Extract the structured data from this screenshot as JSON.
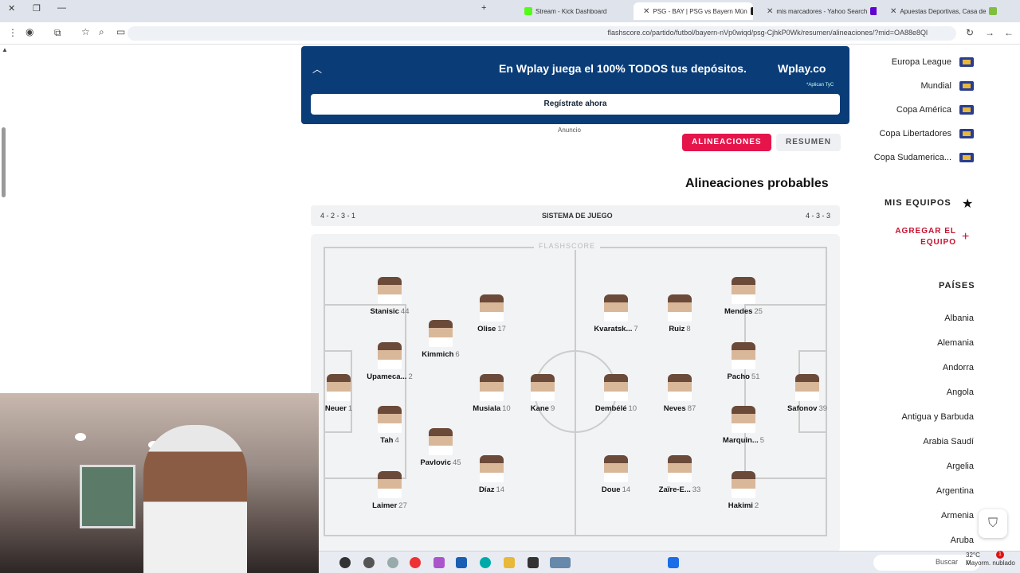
{
  "browser": {
    "tabs": [
      {
        "title": "Apuestas Deportivas, Casa de"
      },
      {
        "title": "mis marcadores - Yahoo Search"
      },
      {
        "title": "PSG - BAY | PSG vs Bayern Mün"
      },
      {
        "title": "Stream - Kick Dashboard"
      }
    ],
    "url": "flashscore.co/partido/futbol/bayern-nVp0wiqd/psg-CjhkP0Wk/resumen/alineaciones/?mid=OA88e8Ql"
  },
  "ad": {
    "brand": "Wplay.co",
    "headline": "En Wplay juega el 100% TODOS tus depósitos.",
    "note": "*Aplican TyC",
    "button": "Regístrate ahora",
    "label": "Anuncio"
  },
  "match_tabs": {
    "resumen": "RESUMEN",
    "alineaciones": "ALINEACIONES"
  },
  "lineup": {
    "title": "Alineaciones probables",
    "system_label": "SISTEMA DE JUEGO",
    "home_formation": "4 - 3 - 3",
    "away_formation": "4 - 2 - 3 - 1",
    "watermark": "FLASHSCORE"
  },
  "players": [
    {
      "num": "25",
      "name": "Mendes"
    },
    {
      "num": "8",
      "name": "Ruiz"
    },
    {
      "num": "7",
      "name": "Kvaratsk..."
    },
    {
      "num": "51",
      "name": "Pacho"
    },
    {
      "num": "39",
      "name": "Safonov"
    },
    {
      "num": "87",
      "name": "Neves"
    },
    {
      "num": "10",
      "name": "Dembélé"
    },
    {
      "num": "5",
      "name": "Marquin..."
    },
    {
      "num": "2",
      "name": "Hakimi"
    },
    {
      "num": "33",
      "name": "Zaïre-E..."
    },
    {
      "num": "14",
      "name": "Doue"
    },
    {
      "num": "44",
      "name": "Stanisic"
    },
    {
      "num": "17",
      "name": "Olise"
    },
    {
      "num": "6",
      "name": "Kimmich"
    },
    {
      "num": "2",
      "name": "Upameca..."
    },
    {
      "num": "1",
      "name": "Neuer"
    },
    {
      "num": "10",
      "name": "Musiala"
    },
    {
      "num": "9",
      "name": "Kane"
    },
    {
      "num": "4",
      "name": "Tah"
    },
    {
      "num": "45",
      "name": "Pavlovic"
    },
    {
      "num": "14",
      "name": "Díaz"
    },
    {
      "num": "27",
      "name": "Laimer"
    }
  ],
  "sidebar": {
    "competitions": [
      "Europa League",
      "Mundial",
      "Copa América",
      "Copa Libertadores",
      "Copa Sudamerica..."
    ],
    "my_teams_title": "MIS EQUIPOS",
    "add_team": "AGREGAR EL EQUIPO",
    "countries_title": "PAÍSES",
    "countries": [
      "Albania",
      "Alemania",
      "Andorra",
      "Angola",
      "Antigua y Barbuda",
      "Arabia Saudí",
      "Argelia",
      "Argentina",
      "Armenia",
      "Aruba"
    ]
  },
  "taskbar": {
    "search": "Buscar",
    "weather_temp": "32°C",
    "weather_desc": "Mayorm. nublado",
    "notification_count": "1"
  },
  "colors": {
    "ad_bg": "#0a3d78",
    "active_tab": "#e5154b",
    "accent": "#c8102e"
  }
}
